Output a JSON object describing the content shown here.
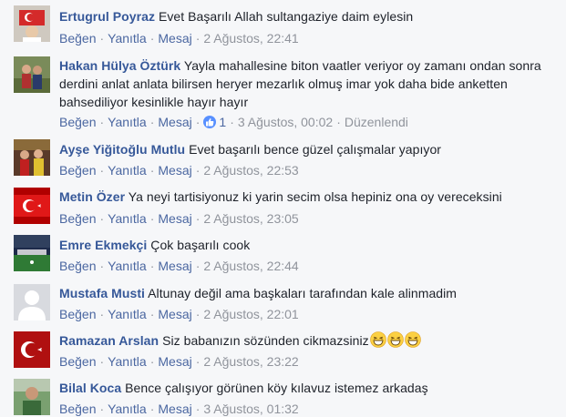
{
  "actions": {
    "like": "Beğen",
    "reply": "Yanıtla",
    "message": "Mesaj",
    "separator": "·"
  },
  "comments": [
    {
      "author": "Ertugrul Poyraz",
      "text": "Evet Başarılı Allah sultangaziye daim eylesin",
      "timestamp": "2 Ağustos, 22:41",
      "avatar": "flag-portrait"
    },
    {
      "author": "Hakan Hülya Öztürk",
      "text": "Yayla mahallesine biton vaatler veriyor oy zamanı ondan sonra derdini anlat anlata bilirsen heryer mezarlık olmuş imar yok daha bide anketten bahsediliyor kesinlikle hayır hayır",
      "timestamp": "3 Ağustos, 00:02",
      "likes": "1",
      "edited": "Düzenlendi",
      "avatar": "couple-photo"
    },
    {
      "author": "Ayşe Yiğitoğlu Mutlu",
      "text": "Evet başarılı bence güzel çalışmalar yapıyor",
      "timestamp": "2 Ağustos, 22:53",
      "avatar": "family-photo"
    },
    {
      "author": "Metin Özer",
      "text": "Ya neyi tartisiyonuz ki yarin secim olsa hepiniz ona oy vereceksini",
      "timestamp": "2 Ağustos, 23:05",
      "avatar": "turkish-flag"
    },
    {
      "author": "Emre Ekmekçi",
      "text": "Çok başarılı cook",
      "timestamp": "2 Ağustos, 22:44",
      "avatar": "stadium-photo"
    },
    {
      "author": "Mustafa Musti",
      "text": "Altunay değil ama başkaları tarafından kale alinmadim",
      "timestamp": "2 Ağustos, 22:01",
      "avatar": "default-silhouette"
    },
    {
      "author": "Ramazan Arslan",
      "text": "Siz babanızın sözünden cikmazsiniz",
      "emojis": [
        "grinning-squinting-face",
        "grinning-squinting-face",
        "grinning-squinting-face"
      ],
      "timestamp": "2 Ağustos, 23:22",
      "avatar": "crescent-flag"
    },
    {
      "author": "Bilal Koca",
      "text": "Bence çalışıyor görünen köy kılavuz istemez arkadaş",
      "timestamp": "3 Ağustos, 01:32",
      "avatar": "outdoor-portrait"
    }
  ]
}
